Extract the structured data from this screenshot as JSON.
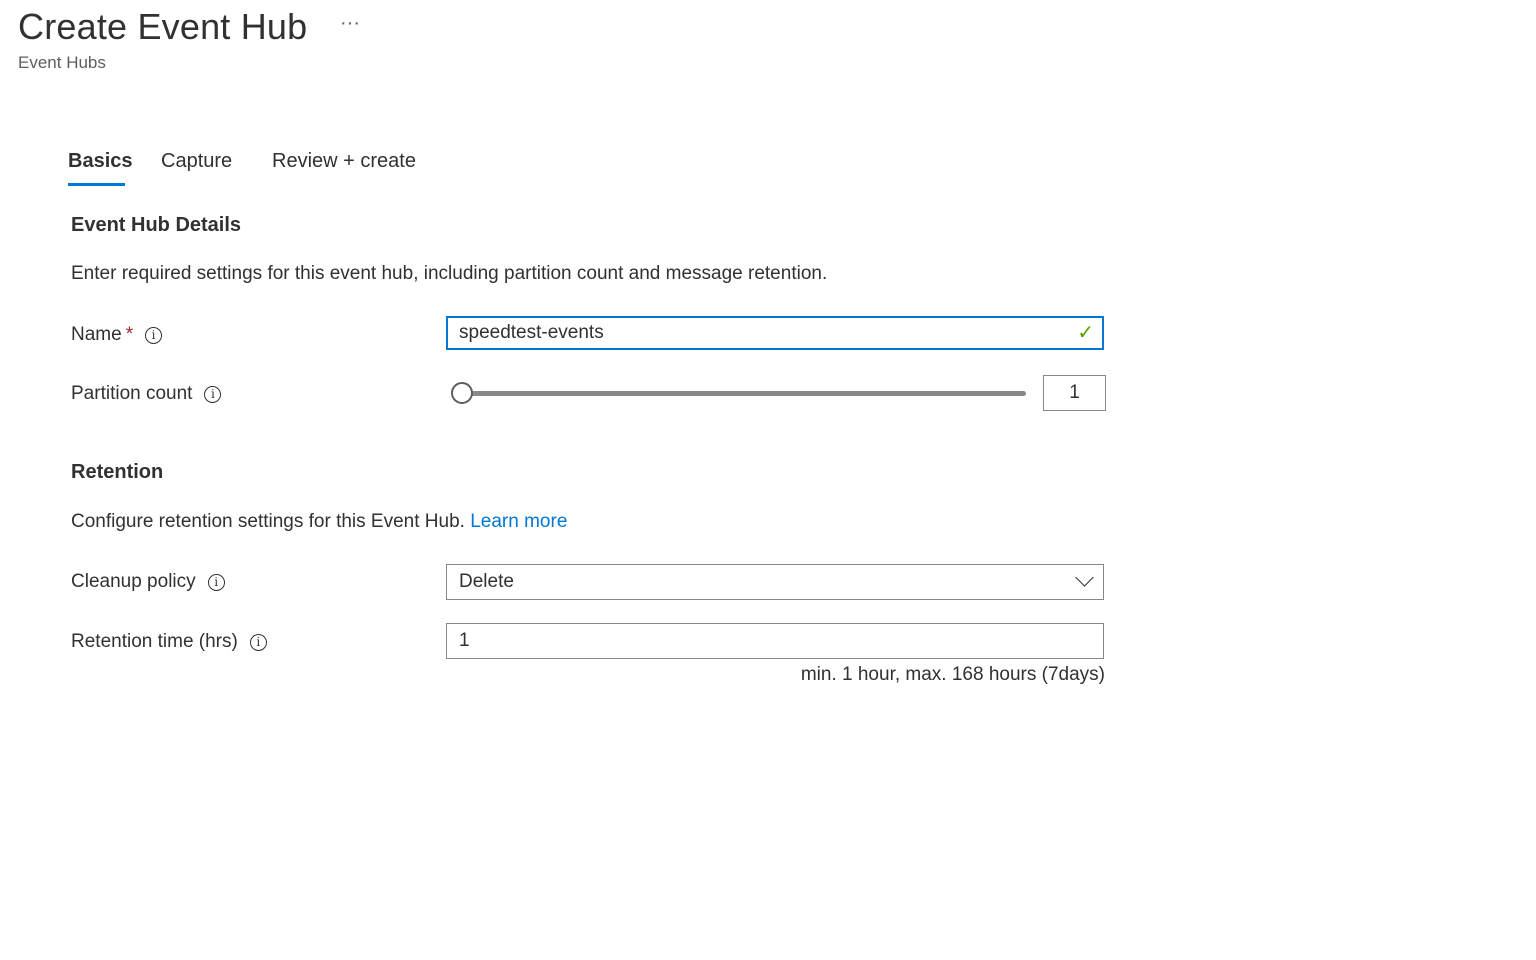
{
  "header": {
    "title": "Create Event Hub",
    "more_label": "···",
    "subtitle": "Event Hubs"
  },
  "tabs": [
    {
      "label": "Basics",
      "active": true
    },
    {
      "label": "Capture"
    },
    {
      "label": "Review + create"
    }
  ],
  "details": {
    "title": "Event Hub Details",
    "description": "Enter required settings for this event hub, including partition count and message retention.",
    "name": {
      "label": "Name",
      "required_mark": "*",
      "value": "speedtest-events",
      "valid": true
    },
    "partition": {
      "label": "Partition count",
      "value": "1",
      "slider_fraction": 0
    }
  },
  "retention": {
    "title": "Retention",
    "description": "Configure retention settings for this Event Hub.",
    "learn_more": "Learn more",
    "cleanup": {
      "label": "Cleanup policy",
      "value": "Delete"
    },
    "time": {
      "label": "Retention time (hrs)",
      "value": "1",
      "hint": "min. 1 hour, max. 168 hours (7days)"
    }
  },
  "icons": {
    "info": "i",
    "check": "✓"
  },
  "colors": {
    "accent": "#0078d4",
    "valid": "#57a300",
    "required": "#a4262c"
  }
}
